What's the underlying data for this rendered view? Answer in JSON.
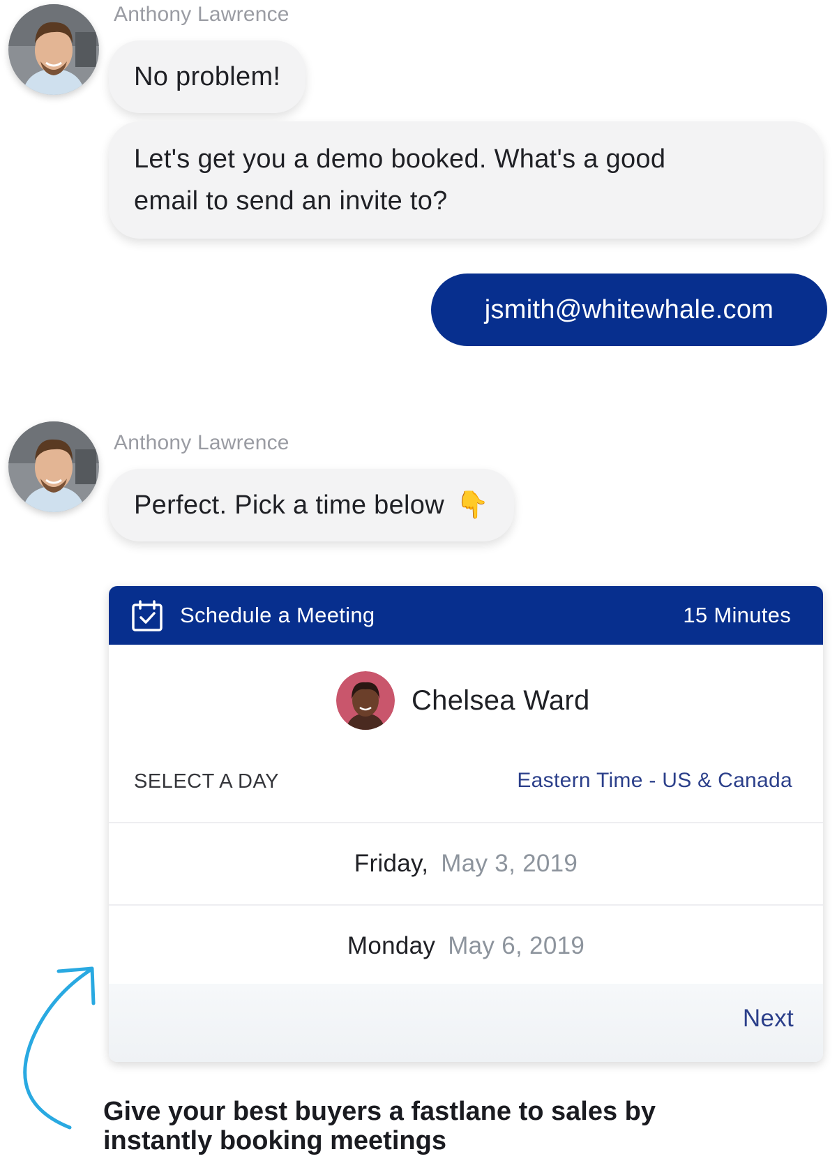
{
  "conversation": {
    "agent_name": "Anthony Lawrence",
    "messages": [
      {
        "text": "No problem!"
      },
      {
        "text_line1": "Let's get you a demo booked. What's a good",
        "text_line2": "email to send an invite to?"
      },
      {
        "text": "jsmith@whitewhale.com"
      },
      {
        "text": "Perfect. Pick a time below",
        "emoji": "👇"
      }
    ]
  },
  "scheduler": {
    "title": "Schedule a Meeting",
    "duration": "15 Minutes",
    "host_name": "Chelsea Ward",
    "select_label": "SELECT A DAY",
    "timezone": "Eastern Time - US & Canada",
    "days": [
      {
        "weekday": "Friday,",
        "date": "May 3, 2019"
      },
      {
        "weekday": "Monday",
        "date": "May 6, 2019"
      }
    ],
    "next_label": "Next"
  },
  "caption": {
    "part1": "Give your best buyers a fastlane to sales by",
    "part2": "instantly ",
    "part3": "booking meetings"
  },
  "colors": {
    "brand_blue": "#072f8e",
    "link_blue": "#2b3f8a",
    "arrow_cyan": "#29a9e1"
  },
  "icons": [
    "calendar-check-icon",
    "pointing-down-emoji",
    "curved-arrow-icon"
  ]
}
